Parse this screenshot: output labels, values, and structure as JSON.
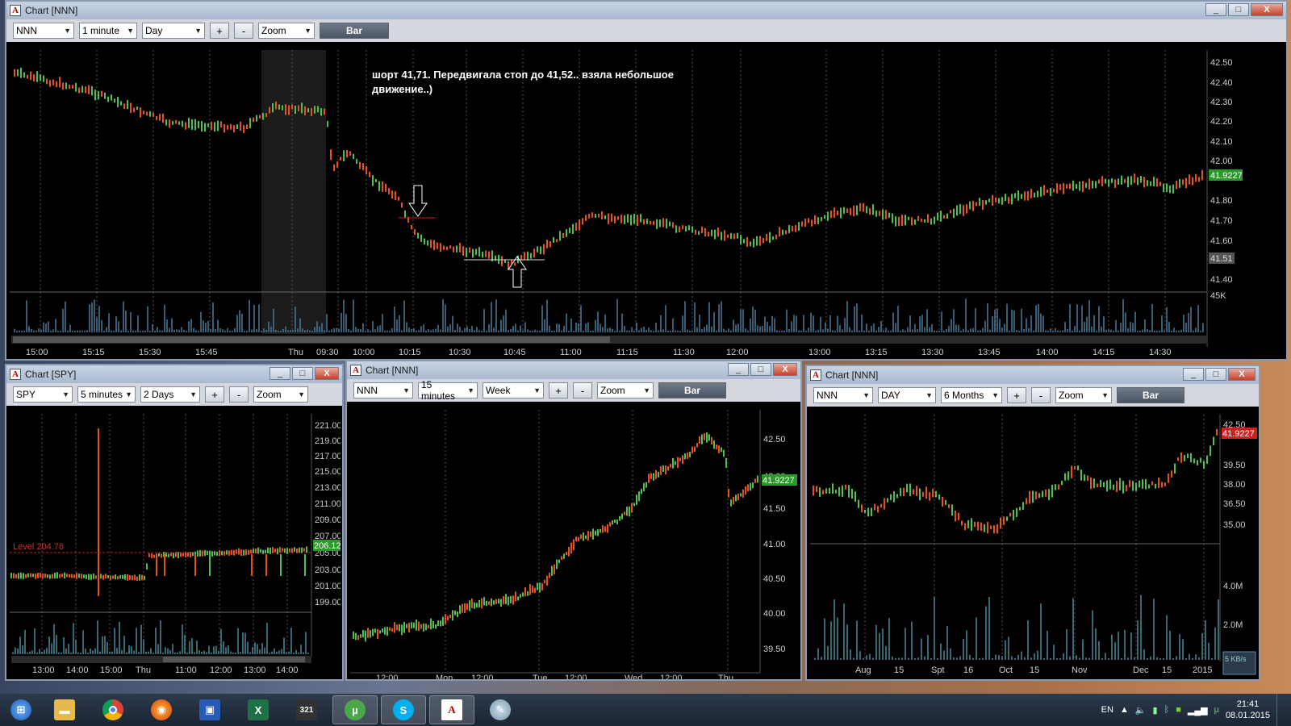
{
  "windows": {
    "main": {
      "title": "Chart [NNN]",
      "symbol": "NNN",
      "interval": "1 minute",
      "range": "Day",
      "zoom": "Zoom",
      "chart_type": "Bar",
      "annotation_line1": "шорт 41,71. Передвигала стоп до 41,52.. взяла небольшое",
      "annotation_line2": "движение..)",
      "price_label": "41.9227",
      "stop_label": "41.51",
      "volume_label": "45K",
      "yticks": [
        "42.50",
        "42.40",
        "42.30",
        "42.20",
        "42.10",
        "42.00",
        "41.80",
        "41.70",
        "41.60",
        "41.40"
      ],
      "xticks": [
        "15:00",
        "15:15",
        "15:30",
        "15:45",
        "Thu",
        "09:30",
        "10:00",
        "10:15",
        "10:30",
        "10:45",
        "11:00",
        "11:15",
        "11:30",
        "12:00",
        "13:00",
        "13:15",
        "13:30",
        "13:45",
        "14:00",
        "14:15",
        "14:30"
      ]
    },
    "spy": {
      "title": "Chart [SPY]",
      "symbol": "SPY",
      "interval": "5 minutes",
      "range": "2 Days",
      "zoom": "Zoom",
      "level_label": "Level 204.76",
      "price_label": "206.12",
      "yticks": [
        "221.00",
        "219.00",
        "217.00",
        "215.00",
        "213.00",
        "211.00",
        "209.00",
        "207.00",
        "205.00",
        "203.00",
        "201.00",
        "199.00"
      ],
      "xticks": [
        "13:00",
        "14:00",
        "15:00",
        "Thu",
        "11:00",
        "12:00",
        "13:00",
        "14:00"
      ]
    },
    "nnn15": {
      "title": "Chart [NNN]",
      "symbol": "NNN",
      "interval": "15 minutes",
      "range": "Week",
      "zoom": "Zoom",
      "chart_type": "Bar",
      "price_label": "41.9227",
      "yticks": [
        "42.50",
        "42.00",
        "41.50",
        "41.00",
        "40.50",
        "40.00",
        "39.50"
      ],
      "xticks": [
        "12:00",
        "Mon",
        "12:00",
        "Tue",
        "12:00",
        "Wed",
        "12:00",
        "Thu"
      ]
    },
    "nnnday": {
      "title": "Chart [NNN]",
      "symbol": "NNN",
      "interval": "DAY",
      "range": "6 Months",
      "zoom": "Zoom",
      "chart_type": "Bar",
      "price_label": "41.9227",
      "speed_label": "5 KB/s",
      "yticks": [
        "42.50",
        "39.50",
        "38.00",
        "36.50",
        "35.00"
      ],
      "vol_ticks": [
        "4.0M",
        "2.0M"
      ],
      "xticks": [
        "Aug",
        "15",
        "Spt",
        "16",
        "Oct",
        "15",
        "Nov",
        "Dec",
        "15",
        "2015"
      ]
    }
  },
  "buttons": {
    "plus": "+",
    "minus": "-",
    "min": "_",
    "max": "□",
    "close": "X"
  },
  "taskbar": {
    "lang": "EN",
    "time": "21:41",
    "date": "08.01.2015",
    "apps": [
      "start-orb",
      "file-explorer",
      "chrome",
      "firefox",
      "save",
      "excel",
      "clapper",
      "utorrent",
      "skype",
      "alor-trade",
      "paint"
    ]
  }
}
